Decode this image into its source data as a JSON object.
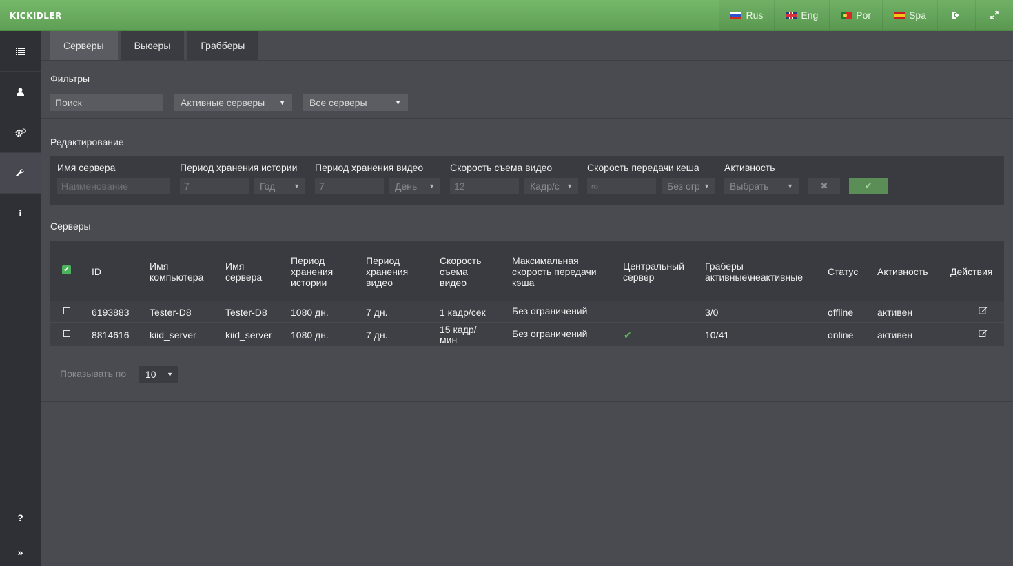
{
  "brand": {
    "logo_text": "KICKIDLER"
  },
  "topbar": {
    "languages": [
      {
        "label": "Rus",
        "flag": "flag-ru-icon"
      },
      {
        "label": "Eng",
        "flag": "flag-gb-icon"
      },
      {
        "label": "Por",
        "flag": "flag-pt-icon"
      },
      {
        "label": "Spa",
        "flag": "flag-es-icon"
      }
    ],
    "icons": {
      "logout": "sign-out-icon",
      "fullscreen": "expand-icon"
    }
  },
  "sidebar": {
    "items": [
      {
        "icon": "list-icon",
        "glyph": "☰"
      },
      {
        "icon": "user-icon",
        "glyph": "●"
      },
      {
        "icon": "gears-icon",
        "glyph": "⚙"
      },
      {
        "icon": "wrench-icon",
        "glyph": "🔧"
      },
      {
        "icon": "info-icon",
        "glyph": "i"
      }
    ],
    "help_glyph": "?",
    "expand_glyph": "»"
  },
  "tabs": [
    {
      "label": "Серверы",
      "active": true
    },
    {
      "label": "Вьюеры",
      "active": false
    },
    {
      "label": "Грабберы",
      "active": false
    }
  ],
  "filters": {
    "title": "Фильтры",
    "search_placeholder": "Поиск",
    "status_select": "Активные серверы",
    "type_select": "Все серверы"
  },
  "edit": {
    "title": "Редактирование",
    "labels": {
      "server_name": "Имя сервера",
      "history_period": "Период хранения истории",
      "video_period": "Период хранения видео",
      "video_rate": "Скорость съема видео",
      "cache_rate": "Скорость передачи кеша",
      "activity": "Активность"
    },
    "fields": {
      "server_name_placeholder": "Наименование",
      "history_value": "7",
      "history_unit": "Год",
      "video_value": "7",
      "video_unit": "День",
      "rate_value": "12",
      "rate_unit": "Кадр/с",
      "cache_value": "∞",
      "cache_unit": "Без огр",
      "activity_value": "Выбрать"
    }
  },
  "servers": {
    "title": "Серверы",
    "columns": {
      "id": "ID",
      "computer_name": [
        "Имя",
        "компьютера"
      ],
      "server_name": [
        "Имя",
        "сервера"
      ],
      "history_period": [
        "Период",
        "хранения",
        "истории"
      ],
      "video_period": [
        "Период",
        "хранения",
        "видео"
      ],
      "video_rate": [
        "Скорость",
        "съема",
        "видео"
      ],
      "max_cache": [
        "Максимальная",
        "скорость передачи",
        "кэша"
      ],
      "central": [
        "Центральный",
        "сервер"
      ],
      "grabbers": [
        "Граберы",
        "активные\\неактивные"
      ],
      "status": "Статус",
      "activity": "Активность",
      "actions": "Действия"
    },
    "rows": [
      {
        "id": "6193883",
        "computer_name": "Tester-D8",
        "server_name": "Tester-D8",
        "history_period": "1080 дн.",
        "video_period": "7 дн.",
        "video_rate": [
          "1 кадр/сек"
        ],
        "max_cache": "Без ограничений",
        "central": false,
        "grabbers": "3/0",
        "status": "offline",
        "activity": "активен"
      },
      {
        "id": "8814616",
        "computer_name": "kiid_server",
        "server_name": "kiid_server",
        "history_period": "1080 дн.",
        "video_period": "7 дн.",
        "video_rate": [
          "15 кадр/",
          "мин"
        ],
        "max_cache": "Без ограничений",
        "central": true,
        "grabbers": "10/41",
        "status": "online",
        "activity": "активен"
      }
    ]
  },
  "pagination": {
    "label": "Показывать по",
    "per_page": "10"
  },
  "colors": {
    "accent": "#6aae5f",
    "background": "#4a4b50",
    "sidebar": "#2f3035",
    "check": "#4bb35b"
  }
}
